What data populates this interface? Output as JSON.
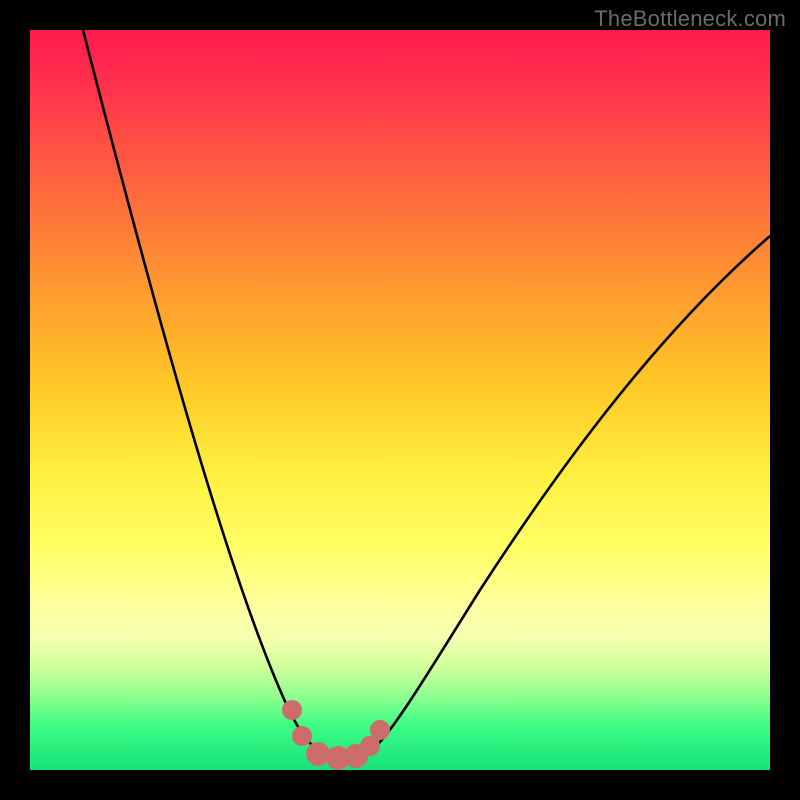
{
  "watermark": {
    "text": "TheBottleneck.com"
  },
  "colors": {
    "curve_stroke": "#000000",
    "dot_fill": "#cd6d6b",
    "dot_stroke": "#8f3e3c",
    "background_black": "#000000"
  },
  "chart_data": {
    "type": "line",
    "title": "",
    "xlabel": "",
    "ylabel": "",
    "xlim": [
      0,
      100
    ],
    "ylim": [
      0,
      100
    ],
    "legend": false,
    "annotations": [
      "TheBottleneck.com"
    ],
    "series": [
      {
        "name": "bottleneck-curve",
        "x": [
          5,
          10,
          15,
          20,
          25,
          30,
          34,
          36,
          38,
          40,
          42,
          44,
          46,
          50,
          55,
          60,
          65,
          70,
          80,
          90,
          100
        ],
        "y": [
          100,
          86,
          72,
          58,
          44,
          30,
          15,
          9,
          4,
          2,
          2,
          2,
          4,
          12,
          22,
          31,
          39,
          46,
          57,
          66,
          73
        ]
      }
    ],
    "markers": [
      {
        "x": 35.5,
        "y": 9,
        "r": 10
      },
      {
        "x": 36.5,
        "y": 5,
        "r": 10
      },
      {
        "x": 38.5,
        "y": 2,
        "r": 12
      },
      {
        "x": 41.0,
        "y": 2,
        "r": 12
      },
      {
        "x": 43.5,
        "y": 2,
        "r": 12
      },
      {
        "x": 45.0,
        "y": 4,
        "r": 10
      },
      {
        "x": 46.0,
        "y": 8,
        "r": 10
      }
    ],
    "notes": "This is a bottleneck/compatibility V-curve without labeled axes, ticks, or gridlines. x and y are normalized 0–100 percentage-style estimates read from geometry since no numeric axes are rendered. Lower y = better (green band near bottom); minimum of the curve lies around x ≈ 40."
  }
}
